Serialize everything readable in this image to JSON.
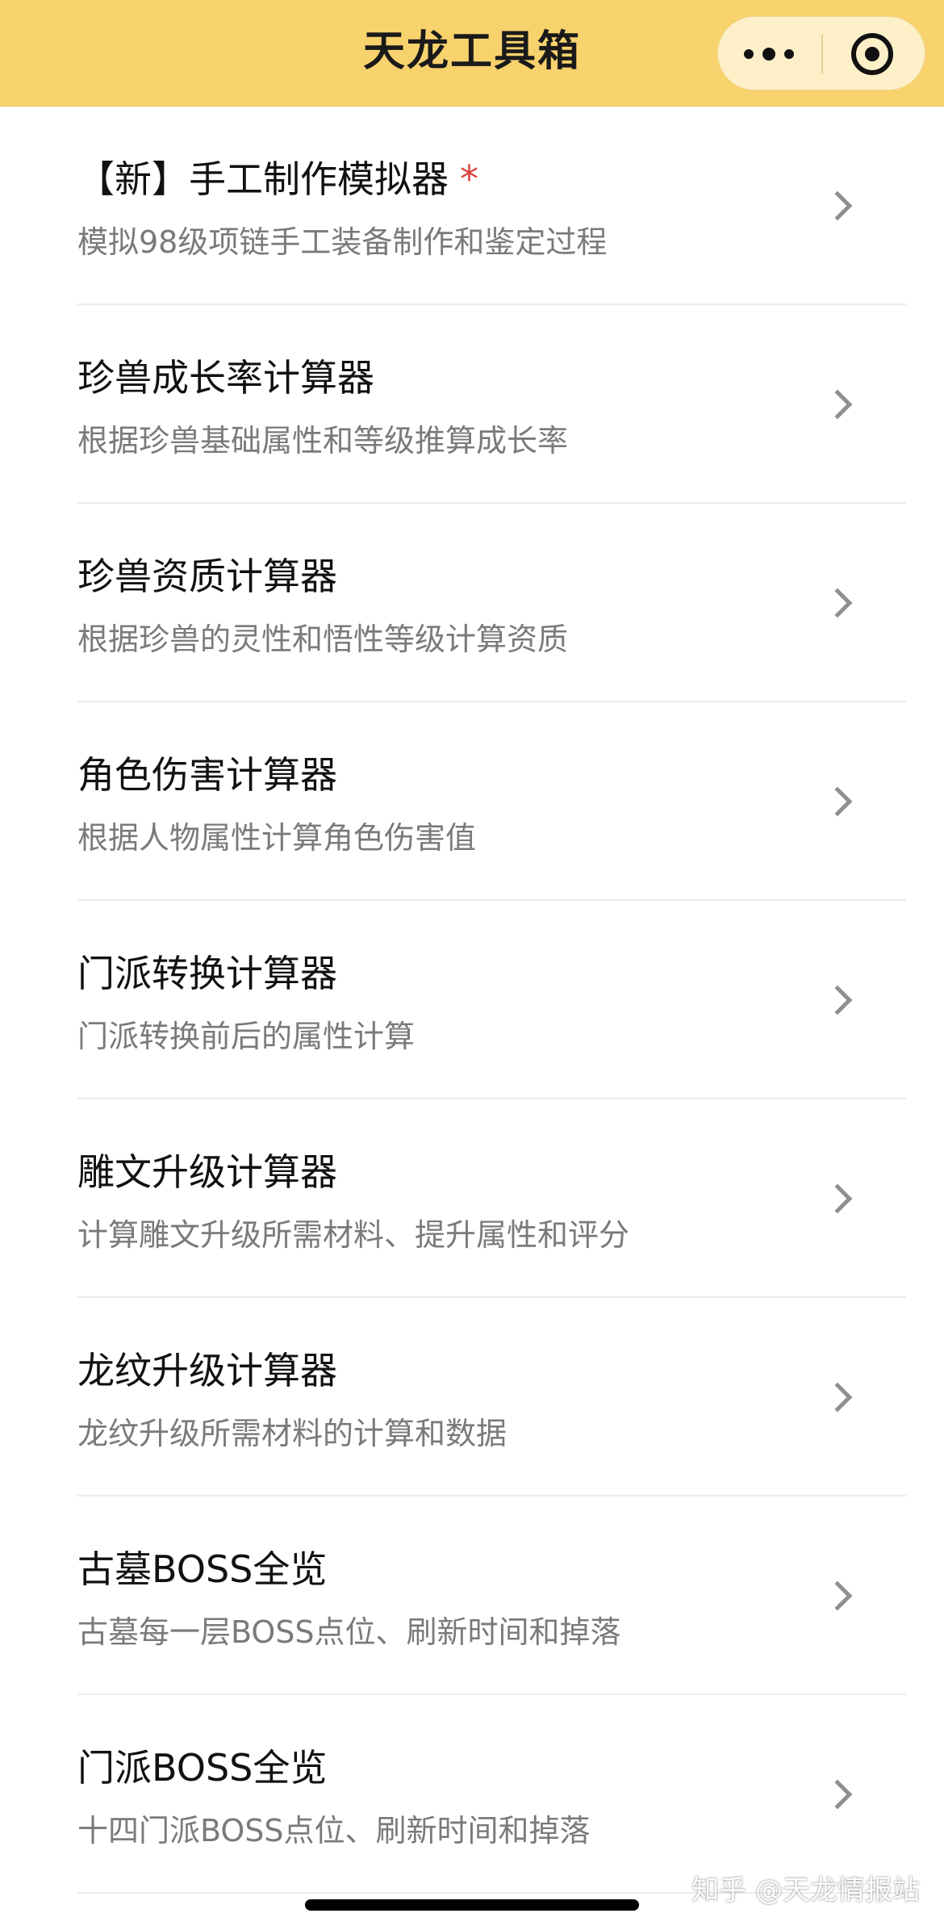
{
  "header": {
    "title": "天龙工具箱",
    "background_color": "#f8d26d",
    "more_icon": "more-dots-icon",
    "close_icon": "target-circle-icon"
  },
  "tools": [
    {
      "title": "【新】手工制作模拟器",
      "badge": "*",
      "subtitle": "模拟98级项链手工装备制作和鉴定过程"
    },
    {
      "title": "珍兽成长率计算器",
      "subtitle": "根据珍兽基础属性和等级推算成长率"
    },
    {
      "title": "珍兽资质计算器",
      "subtitle": "根据珍兽的灵性和悟性等级计算资质"
    },
    {
      "title": "角色伤害计算器",
      "subtitle": "根据人物属性计算角色伤害值"
    },
    {
      "title": "门派转换计算器",
      "subtitle": "门派转换前后的属性计算"
    },
    {
      "title": "雕文升级计算器",
      "subtitle": "计算雕文升级所需材料、提升属性和评分"
    },
    {
      "title": "龙纹升级计算器",
      "subtitle": "龙纹升级所需材料的计算和数据"
    },
    {
      "title": "古墓BOSS全览",
      "subtitle": "古墓每一层BOSS点位、刷新时间和掉落"
    },
    {
      "title": "门派BOSS全览",
      "subtitle": "十四门派BOSS点位、刷新时间和掉落"
    }
  ],
  "chevron_icon": "chevron-right-icon",
  "badge_color": "#e0443c",
  "watermark": "知乎 @天龙情报站"
}
